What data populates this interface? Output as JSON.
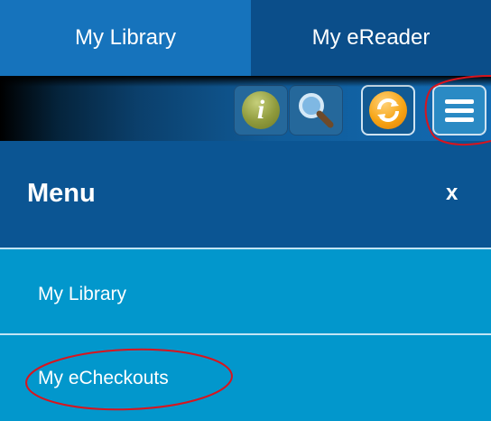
{
  "tabs": [
    {
      "label": "My Library",
      "active": true
    },
    {
      "label": "My eReader",
      "active": false
    }
  ],
  "toolbar": {
    "info_glyph": "i",
    "icons": [
      "info-icon",
      "search-icon",
      "refresh-icon",
      "hamburger-menu-icon"
    ]
  },
  "menu": {
    "title": "Menu",
    "close_label": "x",
    "items": [
      {
        "label": "My Library"
      },
      {
        "label": "My eCheckouts"
      }
    ]
  },
  "colors": {
    "tab_active": "#1673bc",
    "tab_inactive": "#0b4e8a",
    "menu_header": "#0b5593",
    "menu_item": "#0297cc",
    "annotation": "#d9141d"
  }
}
